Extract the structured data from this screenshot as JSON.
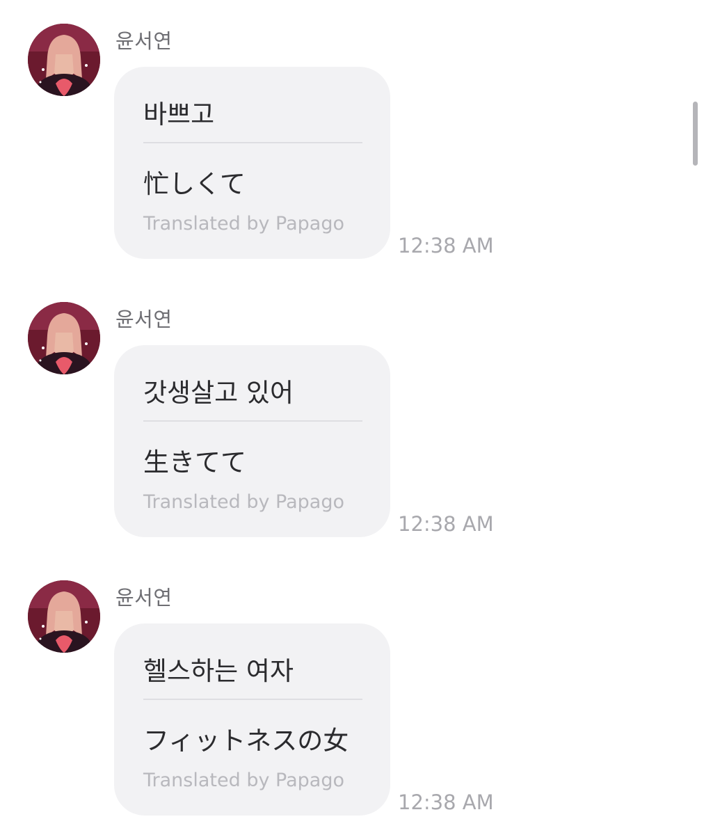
{
  "messages": [
    {
      "sender": "윤서연",
      "original": "바쁘고",
      "translation": "忙しくて",
      "credit": "Translated by Papago",
      "time": "12:38 AM"
    },
    {
      "sender": "윤서연",
      "original": "갓생살고 있어",
      "translation": "生きてて",
      "credit": "Translated by Papago",
      "time": "12:38 AM"
    },
    {
      "sender": "윤서연",
      "original": "헬스하는 여자",
      "translation": "フィットネスの女",
      "credit": "Translated by Papago",
      "time": "12:38 AM"
    }
  ],
  "colors": {
    "bubble": "#f2f2f4",
    "text": "#2b2b2e",
    "muted": "#b8b8bd",
    "avatar_bg": "#6b1a2e"
  },
  "icons": {
    "avatar": "profile-photo"
  }
}
